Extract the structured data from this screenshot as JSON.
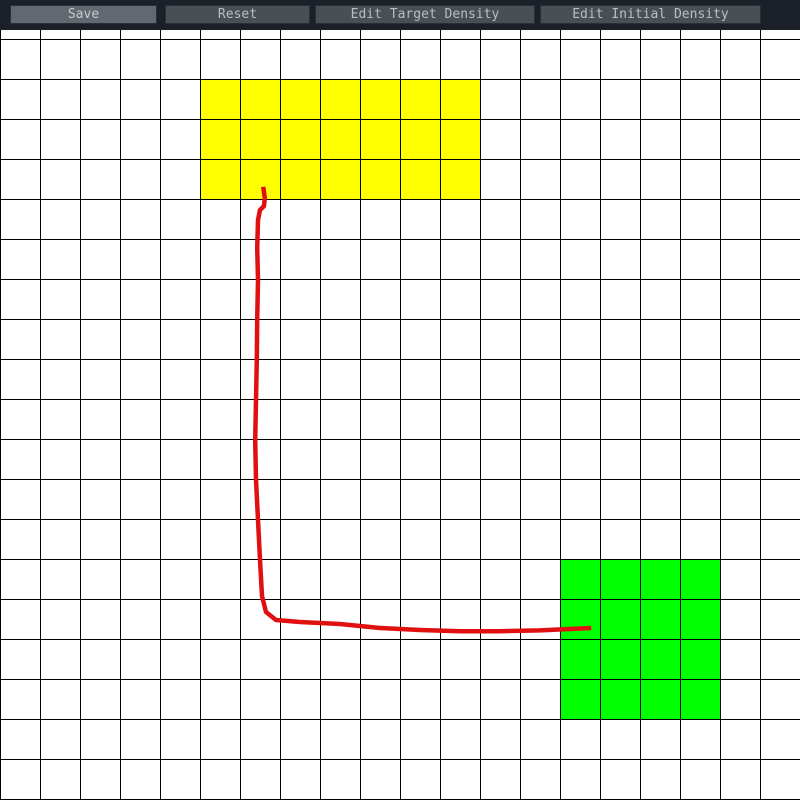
{
  "toolbar": {
    "save_label": "Save",
    "reset_label": "Reset",
    "edit_target_label": "Edit Target Density",
    "edit_initial_label": "Edit Initial Density"
  },
  "grid": {
    "columns": 20,
    "rows": 20,
    "line_color": "#000000",
    "background": "#ffffff"
  },
  "regions": [
    {
      "name": "target-density-region",
      "color": "#ffff00",
      "col_start": 5,
      "col_end": 12,
      "row_start": 2,
      "row_end": 5
    },
    {
      "name": "initial-density-region",
      "color": "#00ff00",
      "col_start": 14,
      "col_end": 18,
      "row_start": 14,
      "row_end": 18
    }
  ],
  "stroke": {
    "color": "#e01010",
    "points_in_cells": [
      [
        6.58,
        4.67
      ],
      [
        6.62,
        4.95
      ],
      [
        6.6,
        5.15
      ],
      [
        6.5,
        5.25
      ],
      [
        6.45,
        5.5
      ],
      [
        6.43,
        6.2
      ],
      [
        6.45,
        7.0
      ],
      [
        6.43,
        8.0
      ],
      [
        6.42,
        9.0
      ],
      [
        6.4,
        10.0
      ],
      [
        6.38,
        11.0
      ],
      [
        6.4,
        12.0
      ],
      [
        6.45,
        13.0
      ],
      [
        6.5,
        14.0
      ],
      [
        6.55,
        14.9
      ],
      [
        6.65,
        15.3
      ],
      [
        6.9,
        15.5
      ],
      [
        7.5,
        15.55
      ],
      [
        8.5,
        15.6
      ],
      [
        9.5,
        15.7
      ],
      [
        10.5,
        15.75
      ],
      [
        11.5,
        15.78
      ],
      [
        12.5,
        15.78
      ],
      [
        13.5,
        15.76
      ],
      [
        14.78,
        15.7
      ]
    ]
  }
}
